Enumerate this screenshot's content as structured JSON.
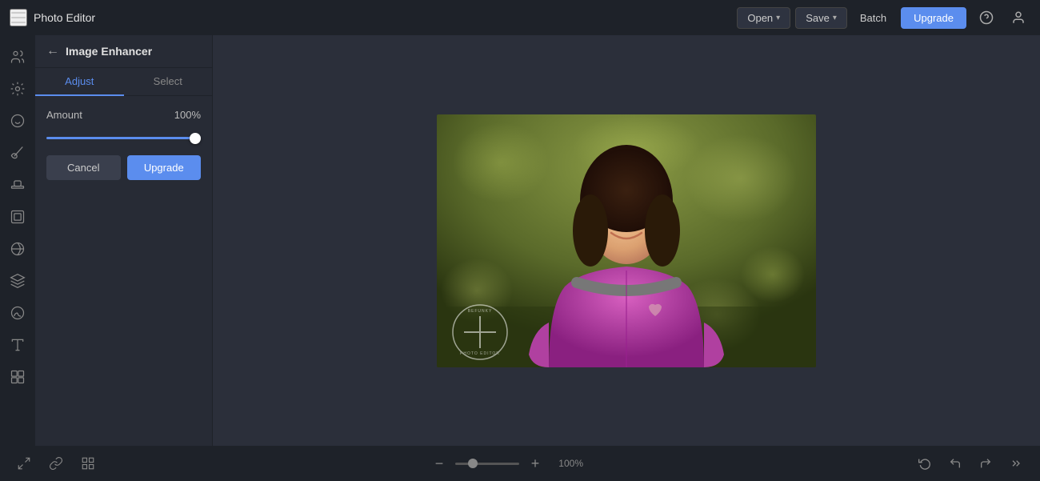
{
  "app": {
    "title": "Photo Editor"
  },
  "topbar": {
    "open_label": "Open",
    "save_label": "Save",
    "batch_label": "Batch",
    "upgrade_label": "Upgrade",
    "help_icon": "?",
    "user_icon": "👤"
  },
  "panel": {
    "back_label": "←",
    "title": "Image Enhancer",
    "tabs": [
      {
        "id": "adjust",
        "label": "Adjust",
        "active": true
      },
      {
        "id": "select",
        "label": "Select",
        "active": false
      }
    ],
    "amount_label": "Amount",
    "amount_value": "100",
    "amount_unit": "%",
    "slider_value": 100,
    "cancel_label": "Cancel",
    "upgrade_label": "Upgrade"
  },
  "bottombar": {
    "zoom_value": "100",
    "zoom_unit": "%",
    "zoom_min": 10,
    "zoom_max": 400,
    "zoom_current": 100
  }
}
